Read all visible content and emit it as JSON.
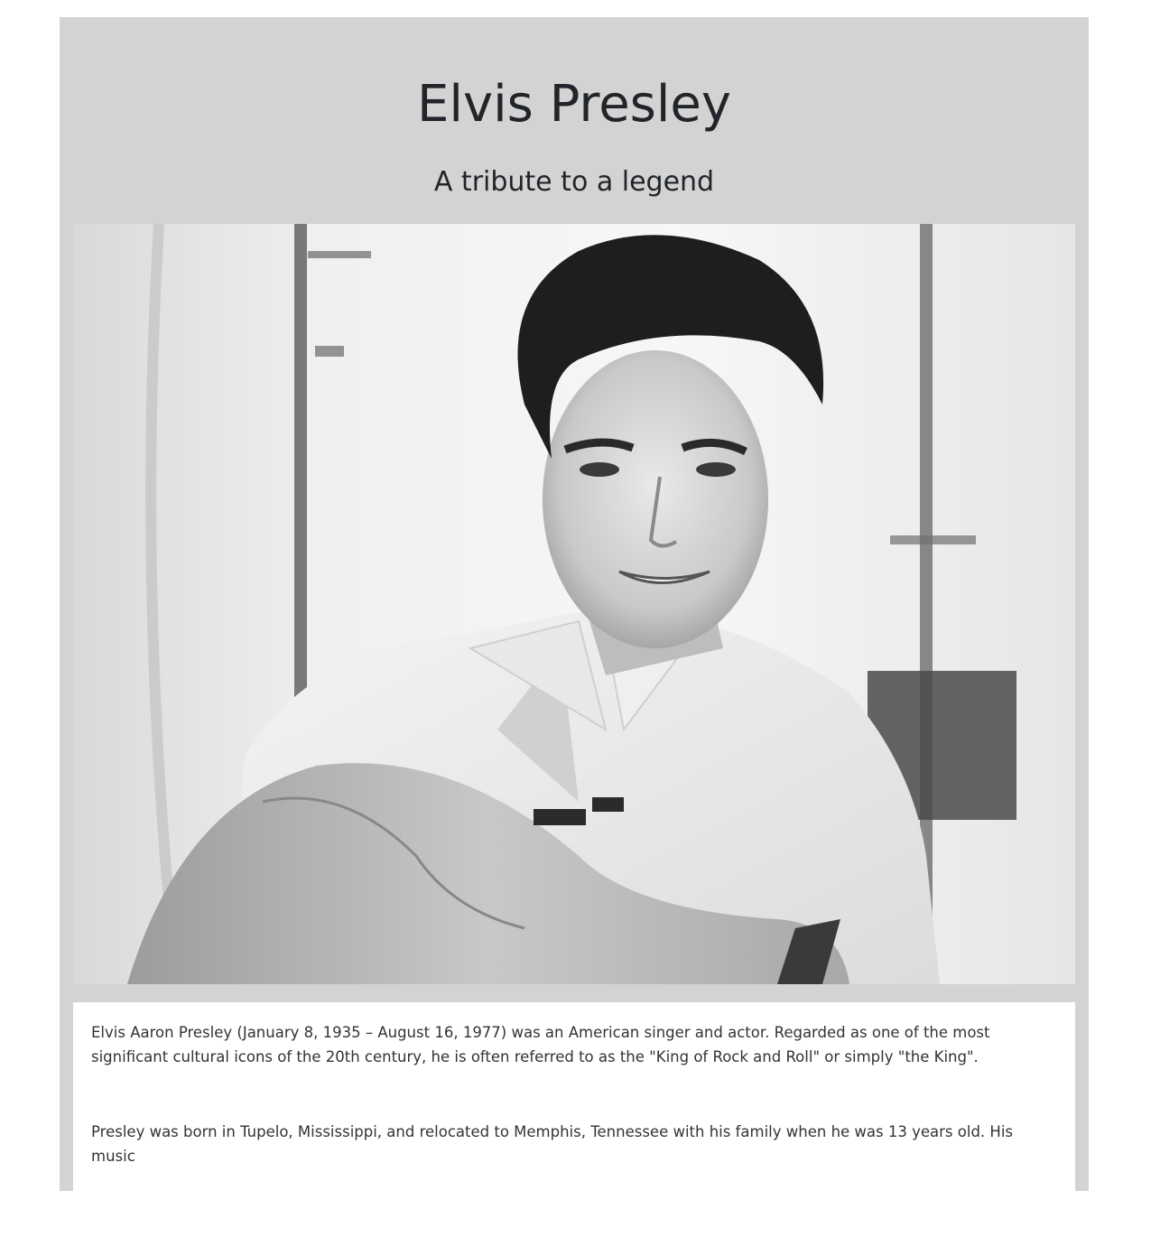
{
  "page": {
    "title": "Elvis Presley",
    "subtitle": "A tribute to a legend"
  },
  "image": {
    "subject": "portrait-photo-of-elvis-presley",
    "style": "black-and-white"
  },
  "tribute": {
    "paragraphs": [
      "Elvis Aaron Presley (January 8, 1935 – August 16, 1977) was an American singer and actor. Regarded as one of the most significant cultural icons of the 20th century, he is often referred to as the \"King of Rock and Roll\" or simply \"the King\".",
      "Presley was born in Tupelo, Mississippi, and relocated to Memphis, Tennessee with his family when he was 13 years old. His music"
    ]
  },
  "colors": {
    "page_background": "#ffffff",
    "main_panel": "#d3d3d3",
    "text": "#212529",
    "body_text": "#333333",
    "info_panel": "#ffffff"
  }
}
